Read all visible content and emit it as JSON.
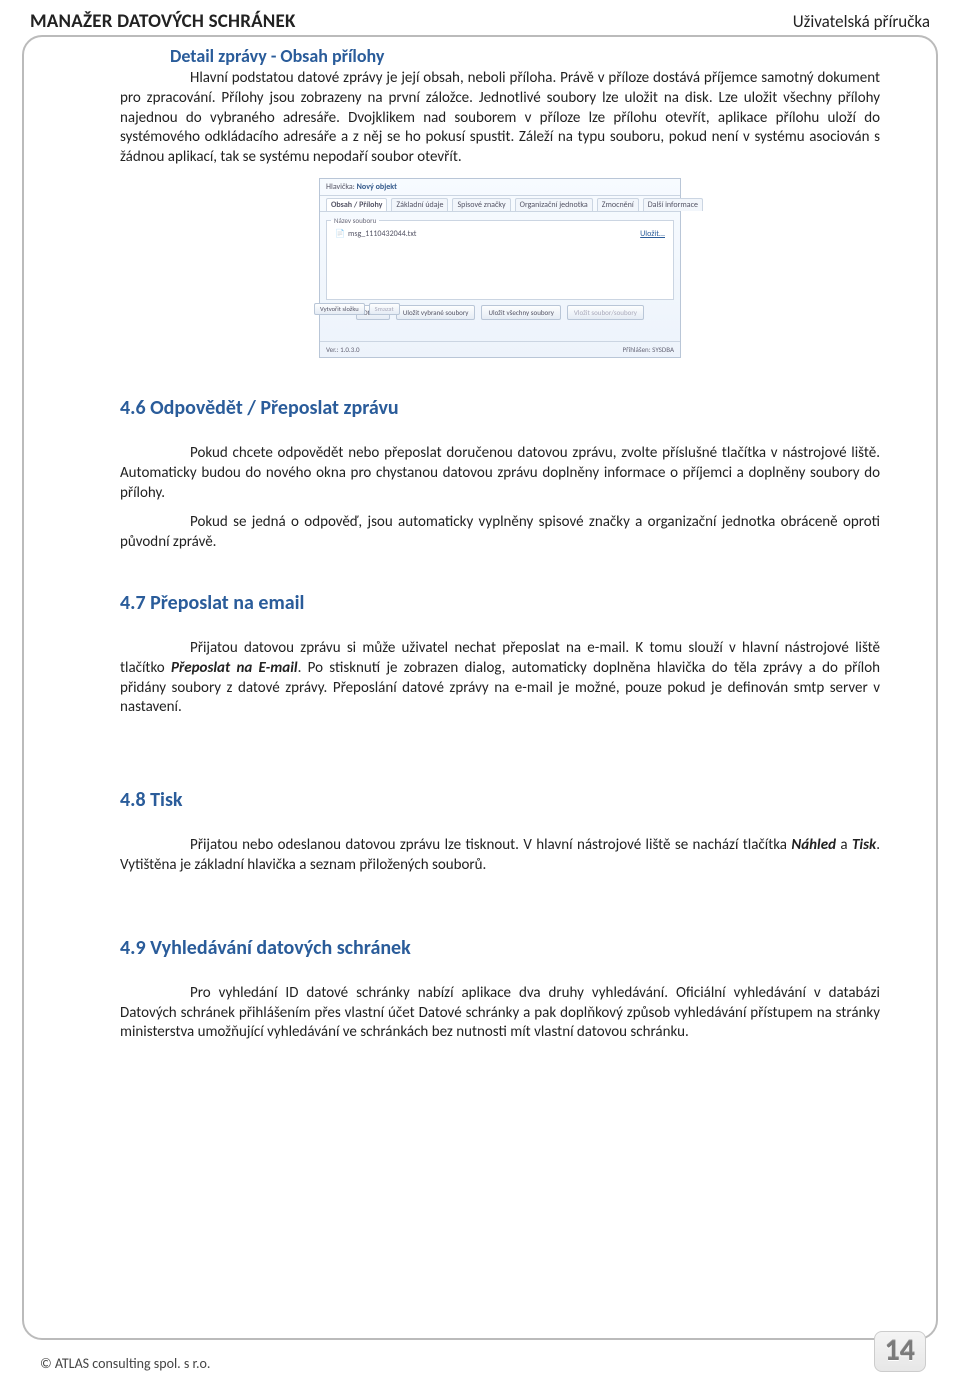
{
  "header": {
    "title": "MANAŽER DATOVÝCH SCHRÁNEK",
    "subtitle": "Uživatelská příručka"
  },
  "section_detail": {
    "heading": "Detail zprávy - Obsah přílohy",
    "para": "Hlavní podstatou datové zprávy je její obsah, neboli příloha. Právě v příloze dostává příjemce samotný dokument pro zpracování. Přílohy jsou zobrazeny na první záložce. Jednotlivé soubory lze uložit na disk. Lze uložit všechny přílohy najednou do vybraného adresáře. Dvojklikem nad souborem v příloze lze přílohu otevřít, aplikace přílohu uloží do systémového odkládacího adresáře a z něj se ho pokusí spustit. Záleží na typu souboru, pokud není v systému asociován s žádnou aplikací, tak se systému nepodaří soubor otevřít."
  },
  "screenshot": {
    "title_label": "Hlavička:",
    "title_value": "Nový objekt",
    "tabs": [
      "Obsah / Přílohy",
      "Základní údaje",
      "Spisové značky",
      "Organizační jednotka",
      "Zmocnění",
      "Další informace"
    ],
    "fieldset_legend": "Název souboru",
    "file_name": "msg_1110432044.txt",
    "save_link": "Uložit...",
    "buttons": {
      "open": "Otevřít",
      "save_selected": "Uložit vybrané soubory",
      "save_all": "Uložit všechny soubory",
      "add_file": "Vložit soubor/soubory"
    },
    "sidebar": {
      "create_folder": "Vytvořit složku",
      "delete": "Smazat"
    },
    "footer": {
      "version": "Ver.: 1.0.3.0",
      "user": "Přihlášen: SYSDBA"
    }
  },
  "s46": {
    "heading": "4.6 Odpovědět / Přeposlat zprávu",
    "p1": "Pokud chcete odpovědět nebo přeposlat doručenou datovou zprávu, zvolte příslušné tlačítka v nástrojové liště. Automaticky budou do nového okna pro chystanou datovou zprávu doplněny informace o příjemci a doplněny soubory do přílohy.",
    "p2": "Pokud se jedná o odpověď, jsou automaticky vyplněny spisové značky a organizační jednotka obráceně oproti původní zprávě."
  },
  "s47": {
    "heading": "4.7 Přeposlat na email",
    "p1_pre": "Přijatou datovou zprávu si může uživatel nechat přeposlat na e-mail. K tomu slouží v hlavní nástrojové liště tlačítko ",
    "p1_bold": "Přeposlat na E-mail",
    "p1_post": ". Po stisknutí je zobrazen dialog, automaticky doplněna hlavička do těla zprávy a do příloh přidány soubory z datové zprávy. Přeposlání datové zprávy na e-mail je možné, pouze pokud je definován smtp server v nastavení."
  },
  "s48": {
    "heading": "4.8 Tisk",
    "p_pre": "Přijatou nebo odeslanou datovou zprávu lze tisknout. V hlavní nástrojové liště se nachází tlačítka ",
    "p_b1": "Náhled",
    "p_mid": " a ",
    "p_b2": "Tisk",
    "p_post": ". Vytištěna je základní hlavička a seznam přiložených souborů."
  },
  "s49": {
    "heading": "4.9 Vyhledávání datových schránek",
    "p1": "Pro vyhledání ID datové schránky nabízí aplikace dva druhy vyhledávání. Oficiální vyhledávání v databázi Datových schránek přihlášením přes vlastní účet  Datové schránky a pak doplňkový způsob vyhledávání přístupem na stránky ministerstva umožňující vyhledávání ve schránkách bez nutnosti mít vlastní datovou schránku."
  },
  "footer": {
    "copyright": "© ATLAS consulting spol. s r.o.",
    "page": "14"
  }
}
